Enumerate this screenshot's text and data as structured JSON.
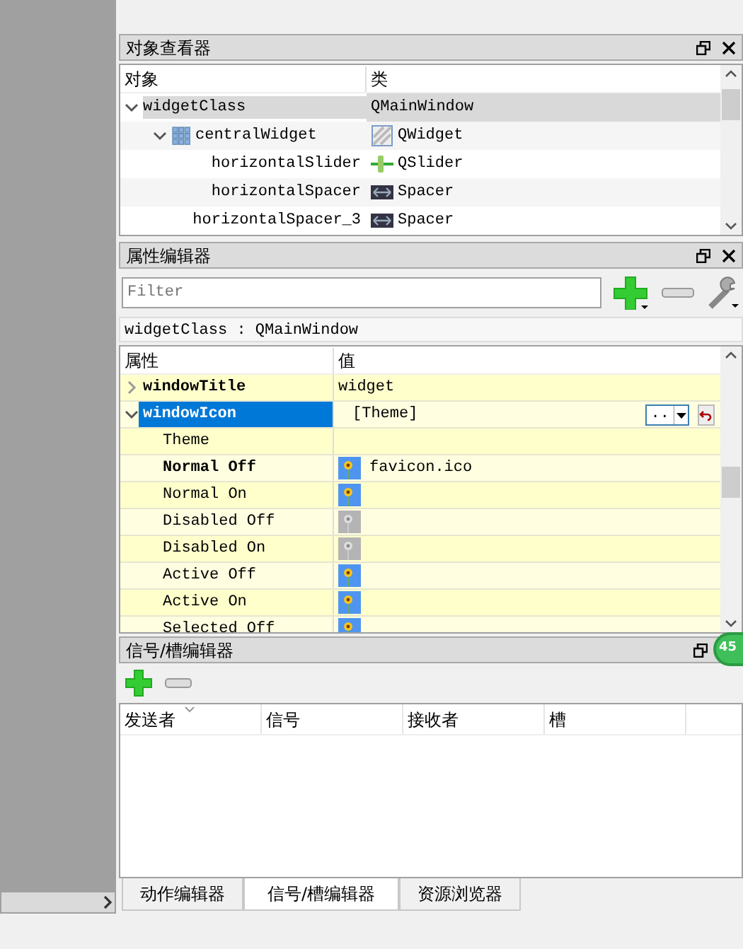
{
  "object_inspector": {
    "title": "对象查看器",
    "columns": [
      "对象",
      "类"
    ],
    "rows": [
      {
        "name": "widgetClass",
        "class": "QMainWindow",
        "expanded": true,
        "selected": true,
        "children": [
          {
            "name": "centralWidget",
            "class": "QWidget",
            "kind": "container",
            "expanded": true,
            "selected": false,
            "children": [
              {
                "name": "horizontalSlider",
                "class": "QSlider",
                "kind": "slider",
                "selected": false
              },
              {
                "name": "horizontalSpacer",
                "class": "Spacer",
                "kind": "spacer",
                "selected": false
              },
              {
                "name": "horizontalSpacer_3",
                "class": "Spacer",
                "kind": "spacer",
                "selected": false
              }
            ]
          }
        ]
      }
    ]
  },
  "property_editor": {
    "title": "属性编辑器",
    "filter": {
      "placeholder": "Filter"
    },
    "object_label": "widgetClass : QMainWindow",
    "columns": [
      "属性",
      "值"
    ],
    "rows": [
      {
        "name": "windowTitle",
        "value": "widget",
        "kind": "property",
        "bold": true,
        "expanded": false,
        "selected": false
      },
      {
        "name": "windowIcon",
        "value": "[Theme]",
        "kind": "property",
        "bold": true,
        "expanded": true,
        "selected": true,
        "browse_button": "..",
        "children": [
          {
            "name": "Theme",
            "kind": "text",
            "bold": false,
            "selected": false
          },
          {
            "name": "Normal Off",
            "kind": "pixmap",
            "value": "favicon.ico",
            "greyed": false,
            "bold": true,
            "selected": false
          },
          {
            "name": "Normal On",
            "kind": "pixmap",
            "greyed": false,
            "bold": false,
            "selected": false
          },
          {
            "name": "Disabled Off",
            "kind": "pixmap",
            "greyed": true,
            "bold": false,
            "selected": false
          },
          {
            "name": "Disabled On",
            "kind": "pixmap",
            "greyed": true,
            "bold": false,
            "selected": false
          },
          {
            "name": "Active Off",
            "kind": "pixmap",
            "greyed": false,
            "bold": false,
            "selected": false
          },
          {
            "name": "Active On",
            "kind": "pixmap",
            "greyed": false,
            "bold": false,
            "selected": false
          },
          {
            "name": "Selected Off",
            "kind": "pixmap",
            "greyed": false,
            "bold": false,
            "selected": false
          }
        ]
      }
    ]
  },
  "signal_slot_editor": {
    "title": "信号/槽编辑器",
    "columns": [
      {
        "label": "发送者",
        "sorted": true
      },
      {
        "label": "信号",
        "sorted": false
      },
      {
        "label": "接收者",
        "sorted": false
      },
      {
        "label": "槽",
        "sorted": false
      }
    ]
  },
  "tabs": [
    {
      "label": "动作编辑器",
      "selected": false
    },
    {
      "label": "信号/槽编辑器",
      "selected": true
    },
    {
      "label": "资源浏览器",
      "selected": false
    }
  ],
  "floating_badge": {
    "text": "45"
  }
}
